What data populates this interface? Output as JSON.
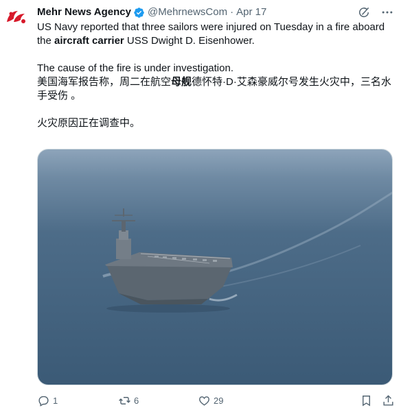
{
  "author": {
    "display_name": "Mehr News Agency",
    "handle": "@MehrnewsCom",
    "separator": "·",
    "date": "Apr 17",
    "verified_badge_color": "#1d9bf0",
    "avatar_color": "#d7192a"
  },
  "header_actions": {
    "grok_icon": "grok-icon",
    "more_icon": "more-icon"
  },
  "tweet": {
    "line1_before": "US Navy reported that three sailors were injured on Tuesday in a fire aboard the ",
    "line1_bold": "aircraft carrier",
    "line1_after": " USS Dwight D. Eisenhower.",
    "line2": "The cause of the fire is under investigation.",
    "zh1_before": "美国海军报告称，周二在航空",
    "zh1_bold": "母舰",
    "zh1_after": "德怀特·D·艾森豪威尔号发生火灾中，三名水手受伤 。",
    "zh2": "火灾原因正在调查中。"
  },
  "media": {
    "subject": "aircraft carrier at sea",
    "sea_color": "#3e5f7c",
    "sky_color": "#8da4ba"
  },
  "actions": {
    "reply_count": "1",
    "retweet_count": "6",
    "like_count": "29",
    "text_color": "#536471"
  }
}
